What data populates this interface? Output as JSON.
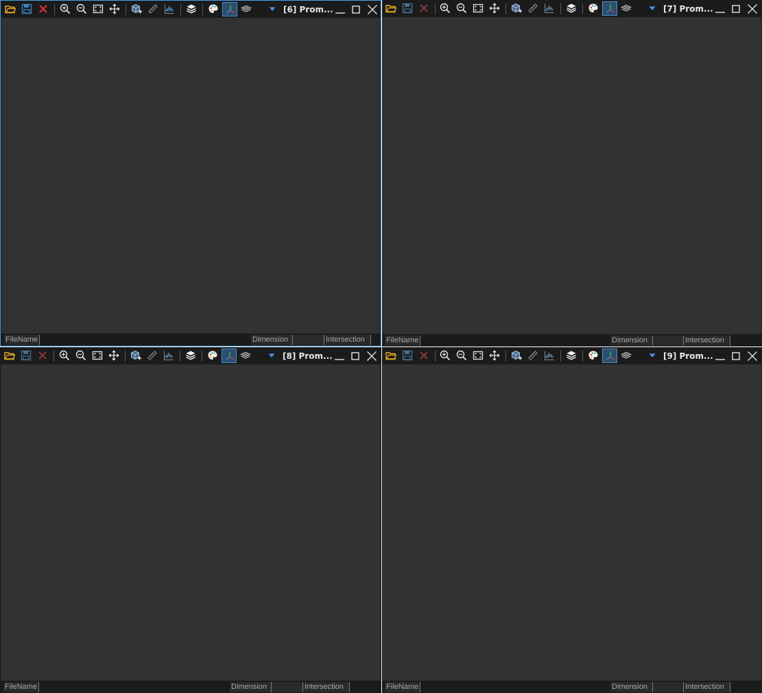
{
  "panes": [
    {
      "id": "pane-6",
      "title": "[6] Prom...",
      "active": true,
      "status": {
        "filename_label": "FileName",
        "dimension_label": "Dimension",
        "intersection_label": "Intersection"
      }
    },
    {
      "id": "pane-7",
      "title": "[7] Prom...",
      "active": false,
      "status": {
        "filename_label": "FileName",
        "dimension_label": "Dimension",
        "intersection_label": "Intersection"
      }
    },
    {
      "id": "pane-8",
      "title": "[8] Prom...",
      "active": false,
      "status": {
        "filename_label": "FileName",
        "dimension_label": "Dimension",
        "intersection_label": "Intersection"
      }
    },
    {
      "id": "pane-9",
      "title": "[9] Prom...",
      "active": false,
      "status": {
        "filename_label": "FileName",
        "dimension_label": "Dimension",
        "intersection_label": "Intersection"
      }
    }
  ],
  "toolbar_icons": [
    "open-folder-icon",
    "save-icon",
    "close-file-icon",
    "zoom-in-icon",
    "zoom-out-icon",
    "fit-view-icon",
    "pan-icon",
    "add-cube-icon",
    "ruler-icon",
    "histogram-icon",
    "layers-icon",
    "palette-icon",
    "axes-icon",
    "slice-plane-icon",
    "dropdown-arrow-icon",
    "minimize-icon",
    "maximize-icon",
    "close-window-icon"
  ],
  "colors": {
    "viewport_bg": "#323232",
    "chrome_bg": "#1b1b1b",
    "active_border": "#4aa3e8",
    "folder": "#f0b020",
    "save": "#3a86c8",
    "close_file": "#d63a3a",
    "accent": "#4a90c8"
  }
}
